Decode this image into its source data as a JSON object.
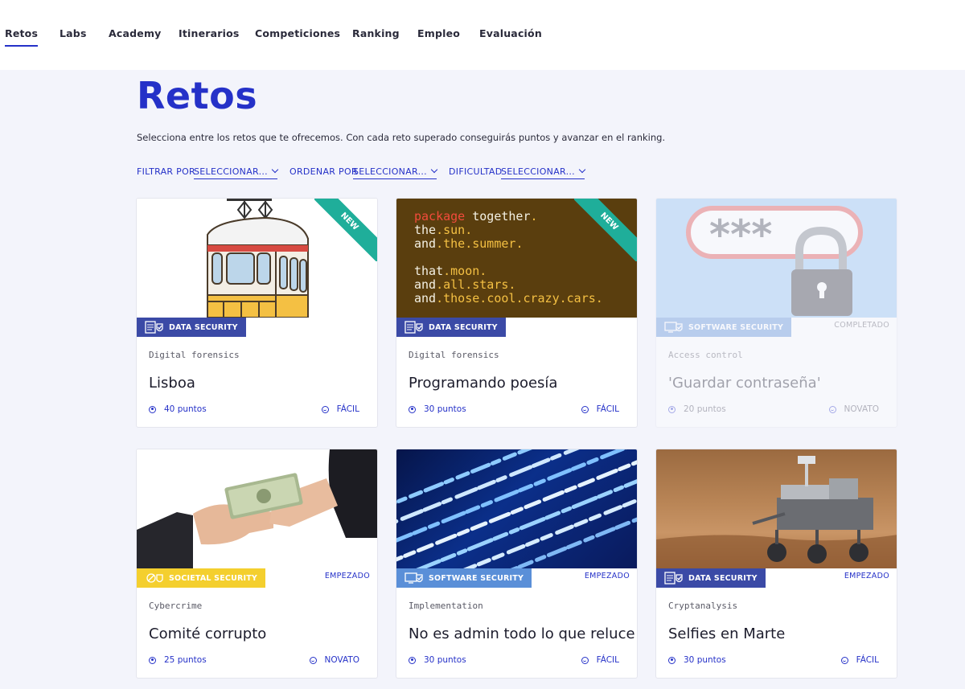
{
  "nav": {
    "items": [
      "Retos",
      "Labs",
      "Academy",
      "Itinerarios",
      "Competiciones",
      "Ranking",
      "Empleo",
      "Evaluación"
    ]
  },
  "page": {
    "title": "Retos",
    "subtitle": "Selecciona entre los retos que te ofrecemos. Con cada reto superado conseguirás puntos y avanzar en el ranking."
  },
  "filters": {
    "filter_label": "FILTRAR POR",
    "filter_value": "SELECCIONAR...",
    "order_label": "ORDENAR POR",
    "order_value": "SELECCIONAR...",
    "difficulty_label": "DIFICULTAD",
    "difficulty_value": "SELECCIONAR..."
  },
  "colors": {
    "accent": "#2531c8",
    "data_security": "#3b4aa6",
    "software_security": "#5a8fd8",
    "societal_security": "#f4cf2e",
    "ribbon": "#1fae9a"
  },
  "poem": {
    "l1a": "package",
    "l1b": "together",
    "l2a": "the",
    "l2b": "sun",
    "l3a": "and",
    "l3b": "the",
    "l3c": "summer",
    "l4a": "that",
    "l4b": "moon",
    "l5a": "and",
    "l5b": "all",
    "l5c": "stars",
    "l6a": "and",
    "l6b": "those",
    "l6c": "cool",
    "l6d": "crazy",
    "l6e": "cars"
  },
  "password_mask": "***",
  "cards": [
    {
      "badge": "DATA SECURITY",
      "status": "",
      "ribbon": "NEW",
      "category": "Digital forensics",
      "title": "Lisboa",
      "points": "40 puntos",
      "level": "FÁCIL"
    },
    {
      "badge": "DATA SECURITY",
      "status": "",
      "ribbon": "NEW",
      "category": "Digital forensics",
      "title": "Programando poesía",
      "points": "30 puntos",
      "level": "FÁCIL"
    },
    {
      "badge": "SOFTWARE SECURITY",
      "status": "COMPLETADO",
      "ribbon": "",
      "category": "Access control",
      "title": "'Guardar contraseña'",
      "points": "20 puntos",
      "level": "NOVATO"
    },
    {
      "badge": "SOCIETAL SECURITY",
      "status": "EMPEZADO",
      "ribbon": "",
      "category": "Cybercrime",
      "title": "Comité corrupto",
      "points": "25 puntos",
      "level": "NOVATO"
    },
    {
      "badge": "SOFTWARE SECURITY",
      "status": "EMPEZADO",
      "ribbon": "",
      "category": "Implementation",
      "title": "No es admin todo lo que reluce",
      "points": "30 puntos",
      "level": "FÁCIL"
    },
    {
      "badge": "DATA SECURITY",
      "status": "EMPEZADO",
      "ribbon": "",
      "category": "Cryptanalysis",
      "title": "Selfies en Marte",
      "points": "30 puntos",
      "level": "FÁCIL"
    }
  ]
}
